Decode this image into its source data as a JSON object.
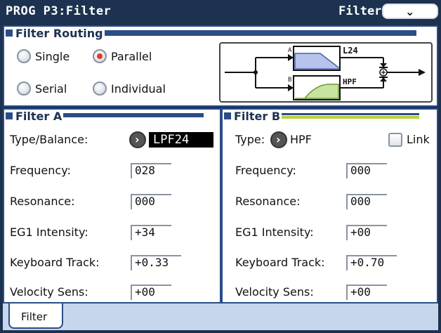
{
  "header": {
    "title": "PROG P3:Filter",
    "page_name": "Filter"
  },
  "colors": {
    "background": "#1c3250",
    "panel_border": "#2a4d86",
    "radio_selected": "#e03a22",
    "diagram_filter_a_fill": "#b7c3ea",
    "diagram_filter_b_fill": "#c9e3a0",
    "tab_bar": "#c7d6ec"
  },
  "routing": {
    "title": "Filter Routing",
    "options": [
      {
        "label": "Single",
        "selected": false
      },
      {
        "label": "Parallel",
        "selected": true
      },
      {
        "label": "Serial",
        "selected": false
      },
      {
        "label": "Individual",
        "selected": false
      }
    ],
    "diagram": {
      "input_a_label": "A",
      "input_b_label": "B",
      "filter_a_type": "L24",
      "filter_b_type": "HPF"
    }
  },
  "filter_a": {
    "title": "Filter A",
    "type_label": "Type/Balance:",
    "type_value": "LPF24",
    "rows": [
      {
        "label": "Frequency:",
        "value": "028"
      },
      {
        "label": "Resonance:",
        "value": "000"
      },
      {
        "label": "EG1 Intensity:",
        "value": "+34"
      },
      {
        "label": "Keyboard Track:",
        "value": "+0.33"
      },
      {
        "label": "Velocity Sens:",
        "value": "+00"
      }
    ]
  },
  "filter_b": {
    "title": "Filter B",
    "type_label": "Type:",
    "type_value": "HPF",
    "link_label": "Link",
    "link_checked": false,
    "rows": [
      {
        "label": "Frequency:",
        "value": "000"
      },
      {
        "label": "Resonance:",
        "value": "000"
      },
      {
        "label": "EG1 Intensity:",
        "value": "+00"
      },
      {
        "label": "Keyboard Track:",
        "value": "+0.70"
      },
      {
        "label": "Velocity Sens:",
        "value": "+00"
      }
    ]
  },
  "tabs": [
    {
      "label": "Filter",
      "active": true
    }
  ]
}
